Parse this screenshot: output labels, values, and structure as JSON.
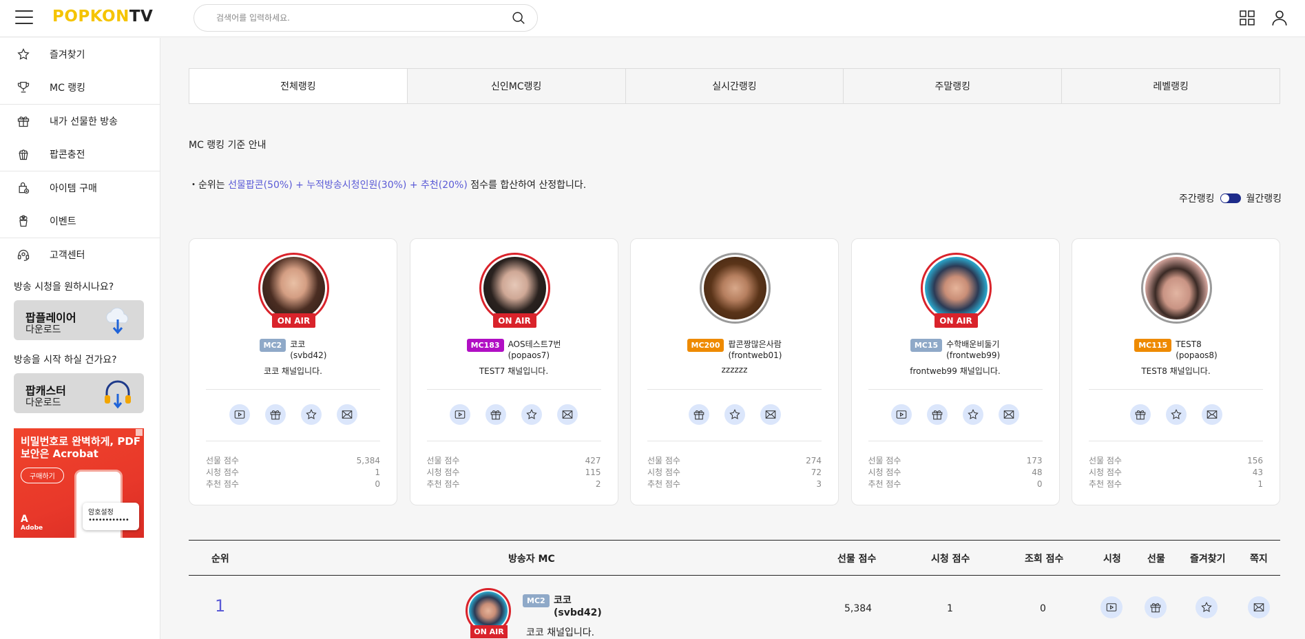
{
  "header": {
    "logo_part1": "POPKON",
    "logo_part2": "TV",
    "search_placeholder": "검색어를 입력하세요."
  },
  "sidebar": {
    "items": [
      {
        "label": "즐겨찾기",
        "icon": "star-icon"
      },
      {
        "label": "MC 랭킹",
        "icon": "trophy-icon"
      },
      {
        "label": "내가 선물한 방송",
        "icon": "gift-icon"
      },
      {
        "label": "팝콘충전",
        "icon": "popcorn-icon"
      },
      {
        "label": "아이템 구매",
        "icon": "item-icon"
      },
      {
        "label": "이벤트",
        "icon": "event-icon"
      },
      {
        "label": "고객센터",
        "icon": "headset-icon"
      }
    ],
    "watch_question": "방송 시청을 원하시나요?",
    "player_title": "팝플레이어",
    "player_sub": "다운로드",
    "start_question": "방송을 시작 하실 건가요?",
    "caster_title": "팝캐스터",
    "caster_sub": "다운로드",
    "ad": {
      "headline": "비밀번호로 완벽하게, PDF 보안은 Acrobat",
      "button": "구매하기",
      "popup": "암호설정",
      "brand": "Adobe"
    }
  },
  "tabs": [
    "전체랭킹",
    "신인MC랭킹",
    "실시간랭킹",
    "주말랭킹",
    "레벨랭킹"
  ],
  "info": {
    "title": "MC 랭킹 기준 안내",
    "desc_prefix": "・순위는 ",
    "desc_highlight": "선물팝콘(50%) + 누적방송시청인원(30%) + 추천(20%)",
    "desc_suffix": " 점수를 합산하여 산정합니다."
  },
  "toggle": {
    "left": "주간랭킹",
    "right": "월간랭킹"
  },
  "score_labels": {
    "gift": "선물 점수",
    "view": "시청 점수",
    "rec": "추천 점수"
  },
  "onair_label": "ON AIR",
  "cards": [
    {
      "badge": "MC2",
      "name": "코코",
      "id": "(svbd42)",
      "desc": "코코 채널입니다.",
      "gift": "5,384",
      "view": "1",
      "rec": "0"
    },
    {
      "badge": "MC183",
      "name": "AOS테스트7번",
      "id": "(popaos7)",
      "desc": "TEST7 채널입니다.",
      "gift": "427",
      "view": "115",
      "rec": "2"
    },
    {
      "badge": "MC200",
      "name": "팝콘짱많은사람",
      "id": "(frontweb01)",
      "desc": "zzzzzz",
      "gift": "274",
      "view": "72",
      "rec": "3"
    },
    {
      "badge": "MC15",
      "name": "수학배운비둘기",
      "id": "(frontweb99)",
      "desc": "frontweb99 채널입니다.",
      "gift": "173",
      "view": "48",
      "rec": "0"
    },
    {
      "badge": "MC115",
      "name": "TEST8",
      "id": "(popaos8)",
      "desc": "TEST8 채널입니다.",
      "gift": "156",
      "view": "43",
      "rec": "1"
    }
  ],
  "table": {
    "headers": {
      "rank": "순위",
      "mc": "방송자 MC",
      "gift": "선물 점수",
      "view": "시청 점수",
      "hits": "조회 점수",
      "watch": "시청",
      "present": "선물",
      "fav": "즐겨찾기",
      "msg": "쪽지"
    },
    "rows": [
      {
        "rank": "1",
        "badge": "MC2",
        "name": "코코",
        "id": "(svbd42)",
        "desc": "코코 채널입니다.",
        "gift": "5,384",
        "view": "1",
        "hits": "0"
      }
    ]
  }
}
